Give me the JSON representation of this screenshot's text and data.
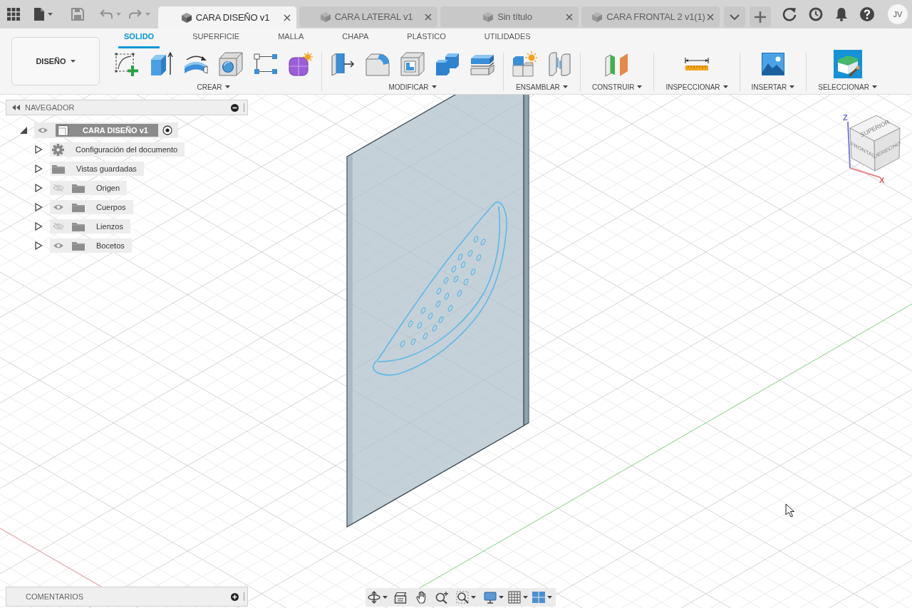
{
  "app_bar": {
    "document_tabs": [
      {
        "label": "CARA DISEÑO v1",
        "selected": true
      },
      {
        "label": "CARA LATERAL v1",
        "selected": false
      },
      {
        "label": "Sin título",
        "selected": false
      },
      {
        "label": "CARA FRONTAL 2 v1(1)",
        "selected": false
      }
    ],
    "user_initials": "JV"
  },
  "ribbon": {
    "workspace": "DISEÑO",
    "tabs": [
      {
        "label": "SOLIDO",
        "selected": true
      },
      {
        "label": "SUPERFICIE",
        "selected": false
      },
      {
        "label": "MALLA",
        "selected": false
      },
      {
        "label": "CHAPA",
        "selected": false
      },
      {
        "label": "PLÁSTICO",
        "selected": false
      },
      {
        "label": "UTILIDADES",
        "selected": false
      }
    ],
    "groups": [
      {
        "label": "CREAR",
        "kind": "create"
      },
      {
        "label": "MODIFICAR",
        "kind": "modify"
      },
      {
        "label": "ENSAMBLAR",
        "kind": "assemble"
      },
      {
        "label": "CONSTRUIR",
        "kind": "construct"
      },
      {
        "label": "INSPECCIONAR",
        "kind": "inspect"
      },
      {
        "label": "INSERTAR",
        "kind": "insert"
      },
      {
        "label": "SELECCIONAR",
        "kind": "select"
      }
    ]
  },
  "navigator": {
    "title": "NAVEGADOR",
    "root": {
      "label": "CARA DISEÑO v1",
      "expanded": true,
      "visible": true,
      "active": true
    },
    "items": [
      {
        "label": "Configuración del documento",
        "kind": "settings",
        "expanded": false
      },
      {
        "label": "Vistas guardadas",
        "kind": "views",
        "expanded": false
      },
      {
        "label": "Origen",
        "kind": "folder",
        "expanded": false,
        "visible": false
      },
      {
        "label": "Cuerpos",
        "kind": "folder",
        "expanded": false,
        "visible": true
      },
      {
        "label": "Lienzos",
        "kind": "folder",
        "expanded": false,
        "visible": false
      },
      {
        "label": "Bocetos",
        "kind": "folder",
        "expanded": false,
        "visible": true
      }
    ]
  },
  "view_cube": {
    "faces": [
      "SUPERIOR",
      "FRONTAL",
      "DERECHO"
    ],
    "axes": [
      "Z",
      "X"
    ]
  },
  "comments": {
    "title": "COMENTARIOS"
  }
}
